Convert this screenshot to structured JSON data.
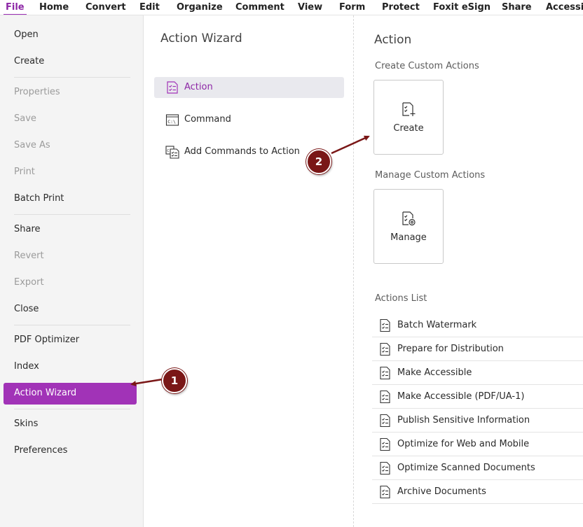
{
  "menubar": {
    "items": [
      "File",
      "Home",
      "Convert",
      "Edit",
      "Organize",
      "Comment",
      "View",
      "Form",
      "Protect",
      "Foxit eSign",
      "Share",
      "Accessib"
    ],
    "active": "File"
  },
  "filemenu": {
    "items": [
      {
        "label": "Open",
        "disabled": false
      },
      {
        "label": "Create",
        "disabled": false
      },
      {
        "label": "Properties",
        "disabled": true
      },
      {
        "label": "Save",
        "disabled": true
      },
      {
        "label": "Save As",
        "disabled": true
      },
      {
        "label": "Print",
        "disabled": true
      },
      {
        "label": "Batch Print",
        "disabled": false
      },
      {
        "label": "Share",
        "disabled": false
      },
      {
        "label": "Revert",
        "disabled": true
      },
      {
        "label": "Export",
        "disabled": true
      },
      {
        "label": "Close",
        "disabled": false
      },
      {
        "label": "PDF Optimizer",
        "disabled": false
      },
      {
        "label": "Index",
        "disabled": false
      },
      {
        "label": "Action Wizard",
        "disabled": false,
        "selected": true
      },
      {
        "label": "Skins",
        "disabled": false
      },
      {
        "label": "Preferences",
        "disabled": false
      }
    ]
  },
  "middle": {
    "title": "Action Wizard",
    "items": [
      {
        "label": "Action",
        "icon": "action-checklist-icon",
        "selected": true
      },
      {
        "label": "Command",
        "icon": "command-prompt-icon",
        "selected": false
      },
      {
        "label": "Add Commands to Action",
        "icon": "add-commands-icon",
        "selected": false
      }
    ]
  },
  "right": {
    "title": "Action",
    "create_section": "Create Custom Actions",
    "create_label": "Create",
    "manage_section": "Manage Custom Actions",
    "manage_label": "Manage",
    "list_section": "Actions List",
    "actions": [
      "Batch Watermark",
      "Prepare for Distribution",
      "Make Accessible",
      "Make Accessible (PDF/UA-1)",
      "Publish Sensitive Information",
      "Optimize for Web and Mobile",
      "Optimize Scanned Documents",
      "Archive Documents"
    ]
  },
  "callouts": [
    "1",
    "2"
  ],
  "colors": {
    "accent": "#a133b7",
    "callout": "#7a1717"
  }
}
